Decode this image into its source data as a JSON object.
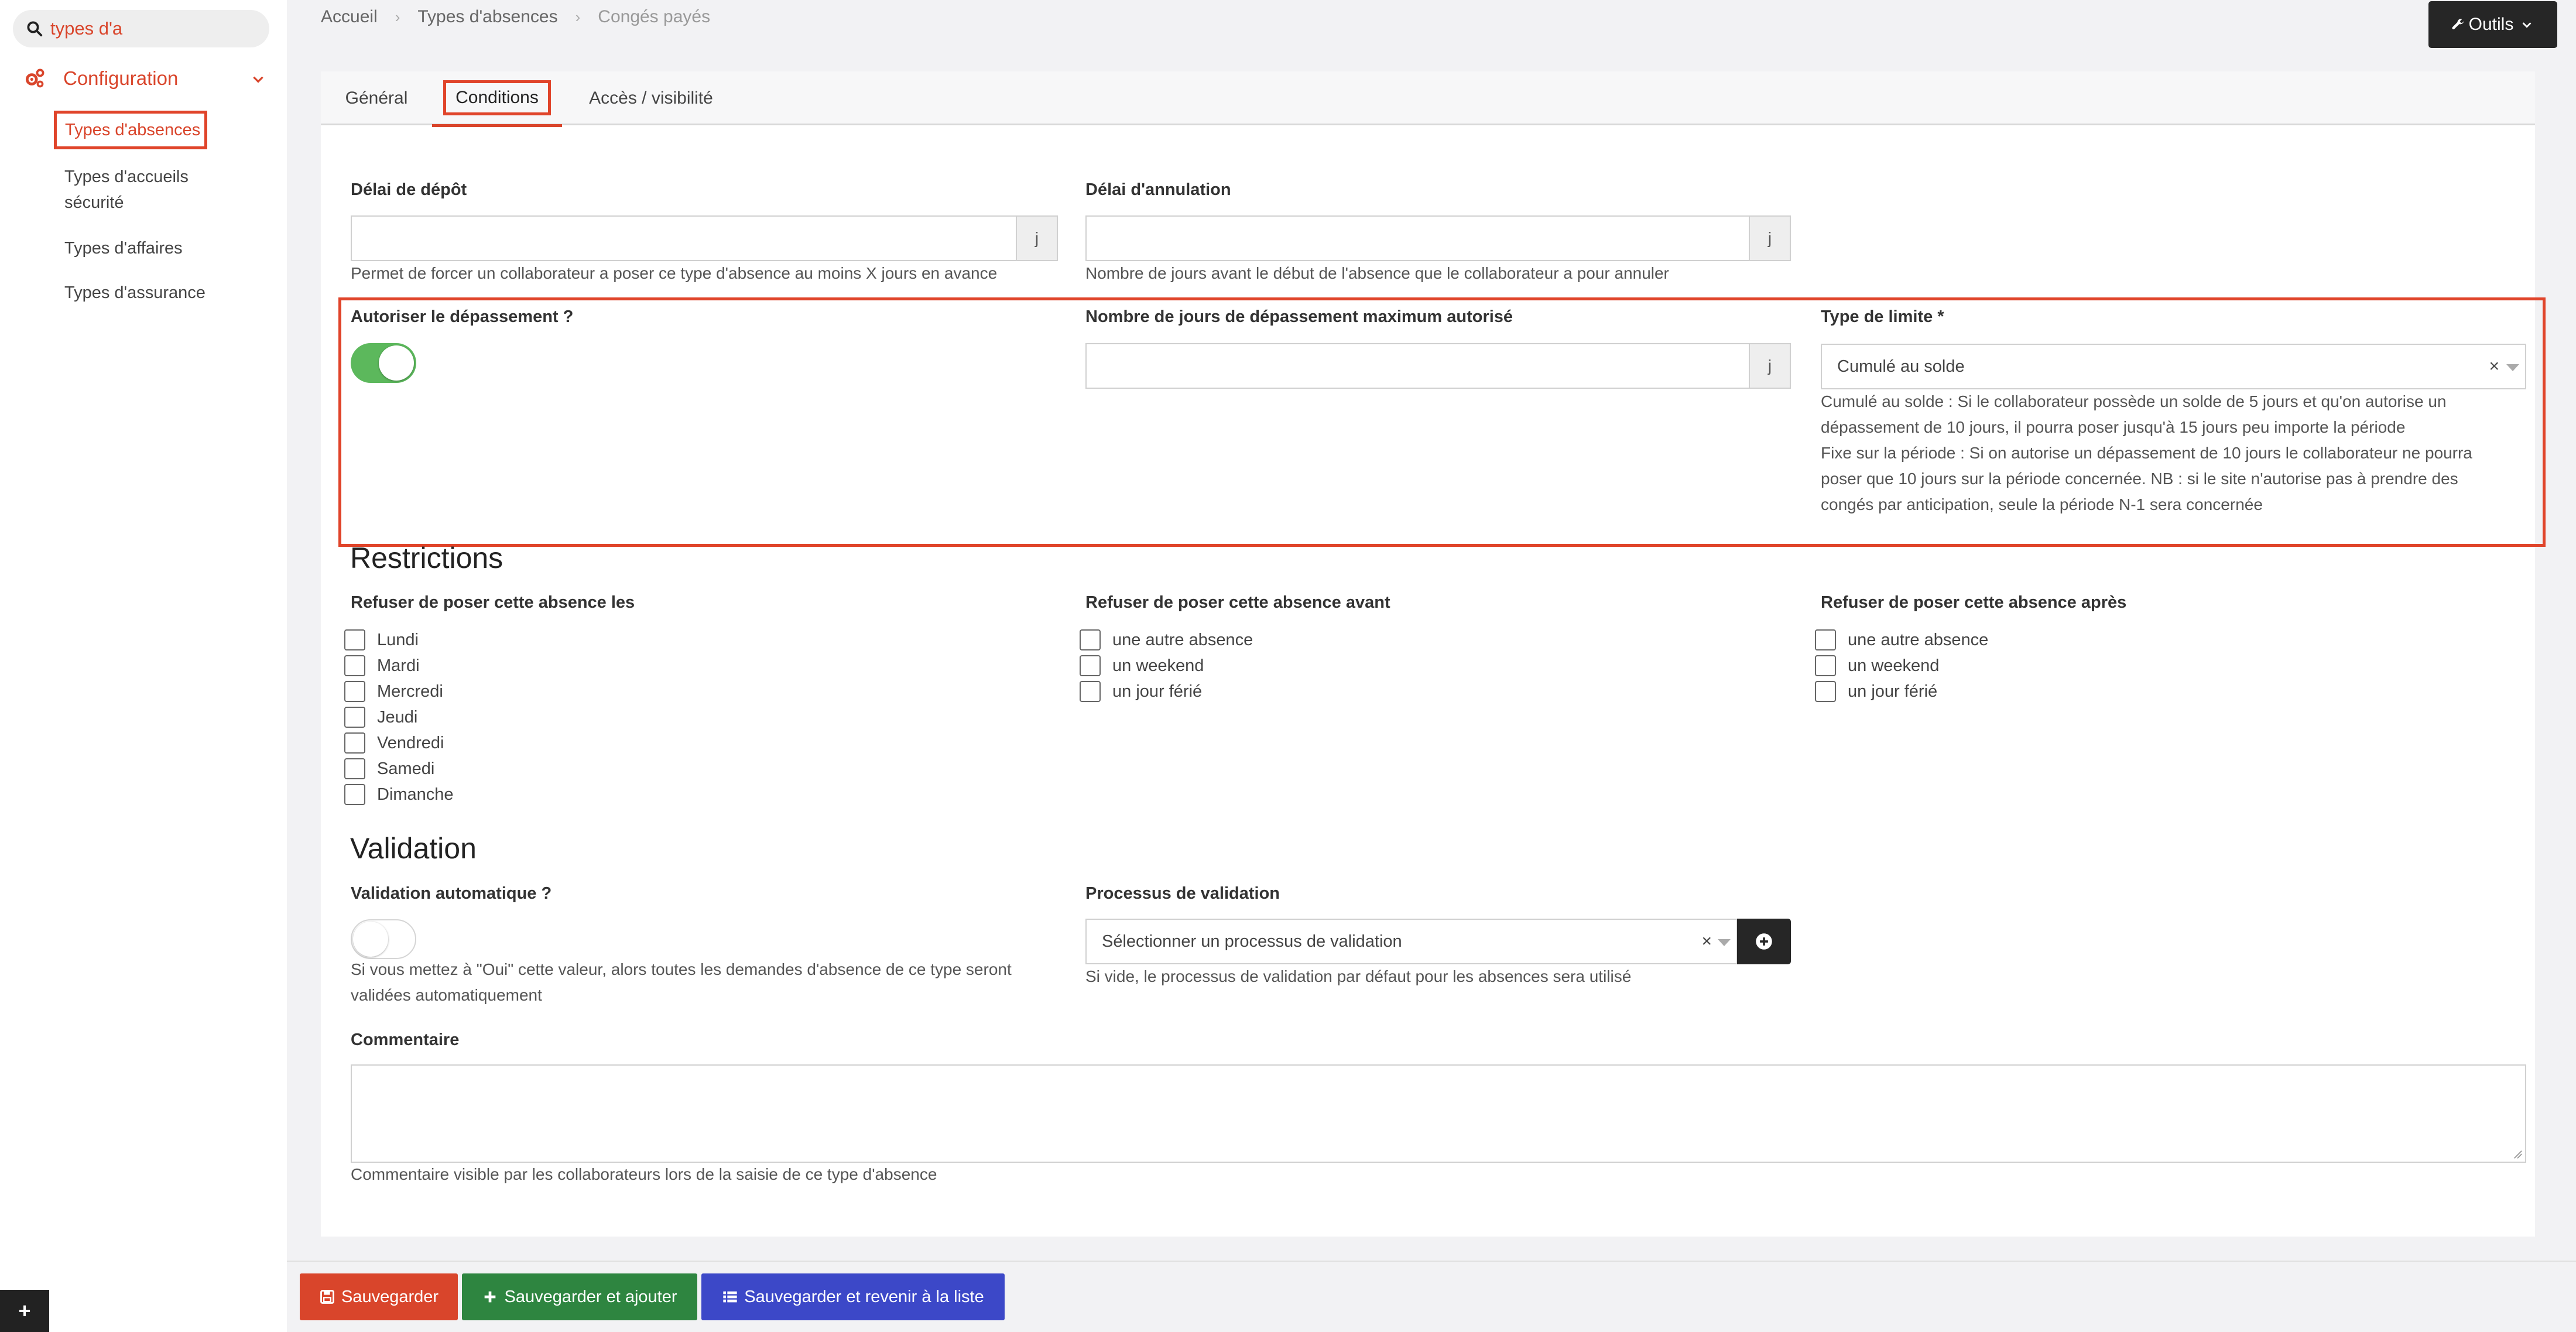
{
  "sidebar": {
    "search_value": "types d'a",
    "section_label": "Configuration",
    "items": [
      {
        "label": "Types d'absences"
      },
      {
        "label": "Types d'accueils"
      },
      {
        "label": "sécurité"
      },
      {
        "label": "Types d'affaires"
      },
      {
        "label": "Types d'assurance"
      }
    ],
    "plus_label": "+"
  },
  "breadcrumb": [
    "Accueil",
    "Types d'absences",
    "Congés payés"
  ],
  "toolbar": {
    "tools_label": "Outils"
  },
  "tabs": [
    {
      "label": "Général"
    },
    {
      "label": "Conditions"
    },
    {
      "label": "Accès / visibilité"
    }
  ],
  "form": {
    "delai_depot": {
      "label": "Délai de dépôt",
      "value": "",
      "unit": "j",
      "help": "Permet de forcer un collaborateur a poser ce type d'absence au moins X jours en avance"
    },
    "delai_annulation": {
      "label": "Délai d'annulation",
      "value": "",
      "unit": "j",
      "help": "Nombre de jours avant le début de l'absence que le collaborateur a pour annuler"
    },
    "depassement": {
      "label": "Autoriser le dépassement ?",
      "checked": true
    },
    "jours_depassement": {
      "label": "Nombre de jours de dépassement maximum autorisé",
      "value": "",
      "unit": "j"
    },
    "type_limite": {
      "label": "Type de limite *",
      "value": "Cumulé au solde",
      "clear": "×",
      "help_lines": [
        "Cumulé au solde : Si le collaborateur possède un solde de 5 jours et qu'on autorise un",
        "dépassement de 10 jours, il pourra poser jusqu'à 15 jours peu importe la période",
        "Fixe sur la période : Si on autorise un dépassement de 10 jours le collaborateur ne pourra",
        "poser que 10 jours sur la période concernée. NB : si le site n'autorise pas à prendre des",
        "congés par anticipation, seule la période N-1 sera concernée"
      ]
    }
  },
  "restrictions": {
    "title": "Restrictions",
    "days_label": "Refuser de poser cette absence les",
    "days": [
      "Lundi",
      "Mardi",
      "Mercredi",
      "Jeudi",
      "Vendredi",
      "Samedi",
      "Dimanche"
    ],
    "before_label": "Refuser de poser cette absence avant",
    "before": [
      "une autre absence",
      "un weekend",
      "un jour férié"
    ],
    "after_label": "Refuser de poser cette absence après",
    "after": [
      "une autre absence",
      "un weekend",
      "un jour férié"
    ]
  },
  "validation": {
    "title": "Validation",
    "auto_label": "Validation automatique ?",
    "auto_checked": false,
    "auto_help_lines": [
      "Si vous mettez à \"Oui\" cette valeur, alors toutes les demandes d'absence de ce type seront",
      "validées automatiquement"
    ],
    "process_label": "Processus de validation",
    "process_placeholder": "Sélectionner un processus de validation",
    "process_clear": "×",
    "process_help": "Si vide, le processus de validation par défaut pour les absences sera utilisé"
  },
  "comment": {
    "label": "Commentaire",
    "value": "",
    "help": "Commentaire visible par les collaborateurs lors de la saisie de ce type d'absence"
  },
  "footer": {
    "save": "Sauvegarder",
    "save_add": "Sauvegarder et ajouter",
    "save_list": "Sauvegarder et revenir à la liste"
  },
  "colors": {
    "accent": "#d9452b",
    "toggle_on": "#5cb85c",
    "dark_button": "#262626",
    "save_red": "#d9452b",
    "save_green": "#2e8540",
    "save_blue": "#3c48c8"
  }
}
